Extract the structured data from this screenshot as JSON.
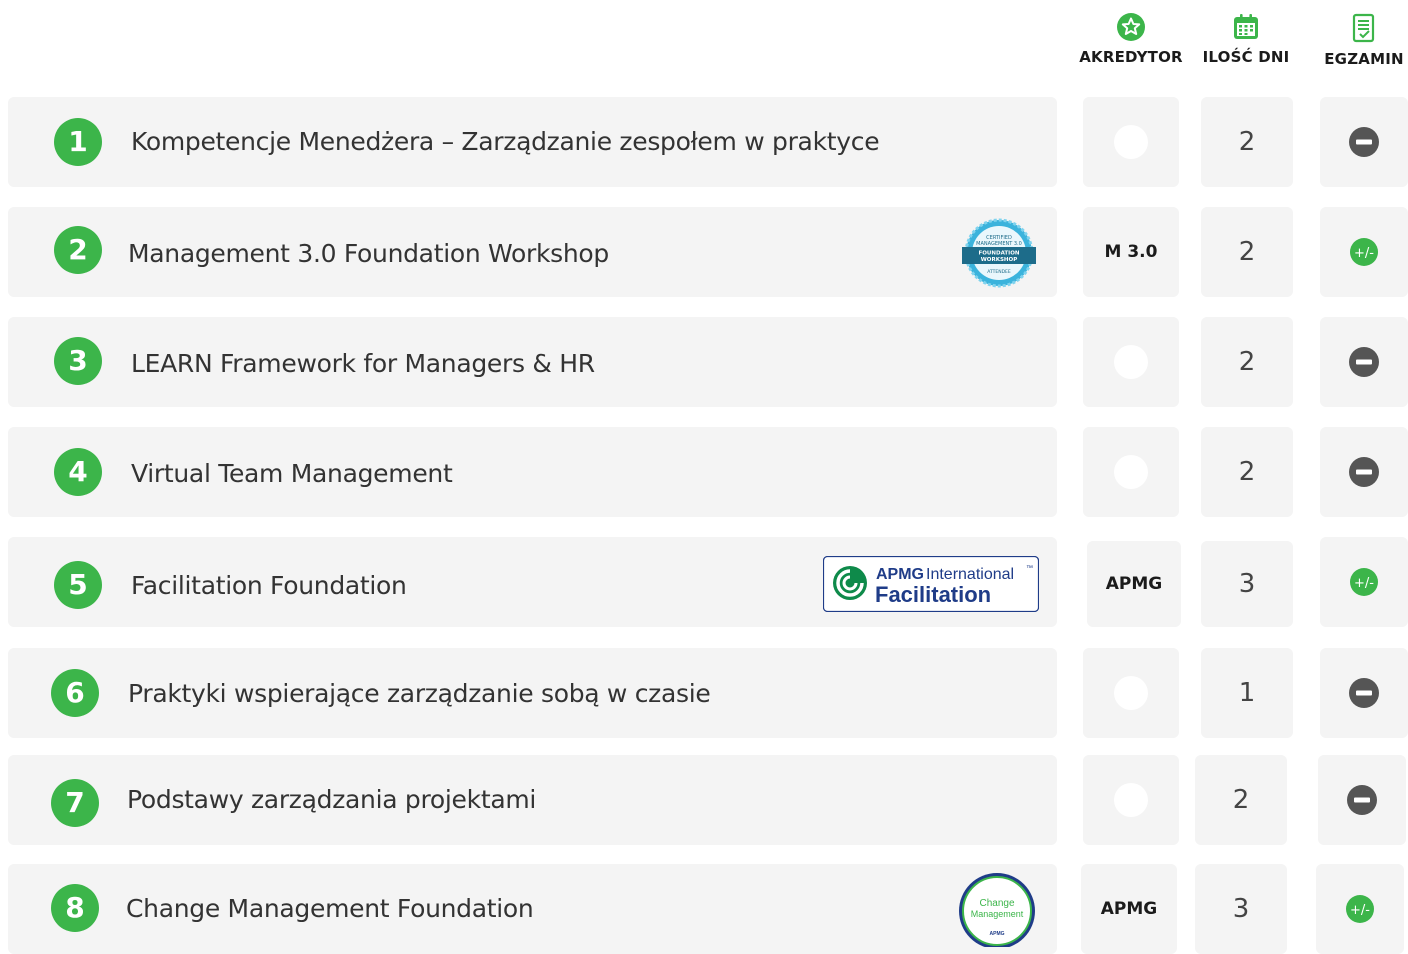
{
  "headers": {
    "accreditor": "AKREDYTOR",
    "days": "ILOŚĆ DNI",
    "exam": "EGZAMIN"
  },
  "colors": {
    "accent": "#3cb54a",
    "cell_bg": "#f4f4f4",
    "no_exam": "#555555",
    "text": "#333333"
  },
  "courses": [
    {
      "number": "1",
      "title": "Kompetencje Menedżera – Zarządzanie zespołem w praktyce",
      "accreditor": "",
      "days": "2",
      "exam": "minus-icon"
    },
    {
      "number": "2",
      "title": "Management 3.0 Foundation Workshop",
      "accreditor": "M 3.0",
      "days": "2",
      "exam": "plus-minus-icon",
      "badge": {
        "lines": [
          "CERTIFIED",
          "MANAGEMENT 3.0"
        ],
        "band1": "FOUNDATION",
        "band2": "WORKSHOP",
        "bottom": "ATTENDEE"
      }
    },
    {
      "number": "3",
      "title": "LEARN Framework for Managers & HR",
      "accreditor": "",
      "days": "2",
      "exam": "minus-icon"
    },
    {
      "number": "4",
      "title": "Virtual Team Management",
      "accreditor": "",
      "days": "2",
      "exam": "minus-icon"
    },
    {
      "number": "5",
      "title": "Facilitation Foundation",
      "accreditor": "APMG",
      "days": "3",
      "exam": "plus-minus-icon",
      "badge": {
        "brand": "APMG",
        "brand_suffix": "International",
        "tm": "™",
        "product": "Facilitation"
      }
    },
    {
      "number": "6",
      "title": "Praktyki wspierające zarządzanie sobą w czasie",
      "accreditor": "",
      "days": "1",
      "exam": "minus-icon"
    },
    {
      "number": "7",
      "title": "Podstawy zarządzania projektami",
      "accreditor": "",
      "days": "2",
      "exam": "minus-icon"
    },
    {
      "number": "8",
      "title": "Change Management Foundation",
      "accreditor": "APMG",
      "days": "3",
      "exam": "plus-minus-icon",
      "badge": {
        "line1": "Change",
        "line2": "Management",
        "mark": "APMG"
      }
    }
  ]
}
